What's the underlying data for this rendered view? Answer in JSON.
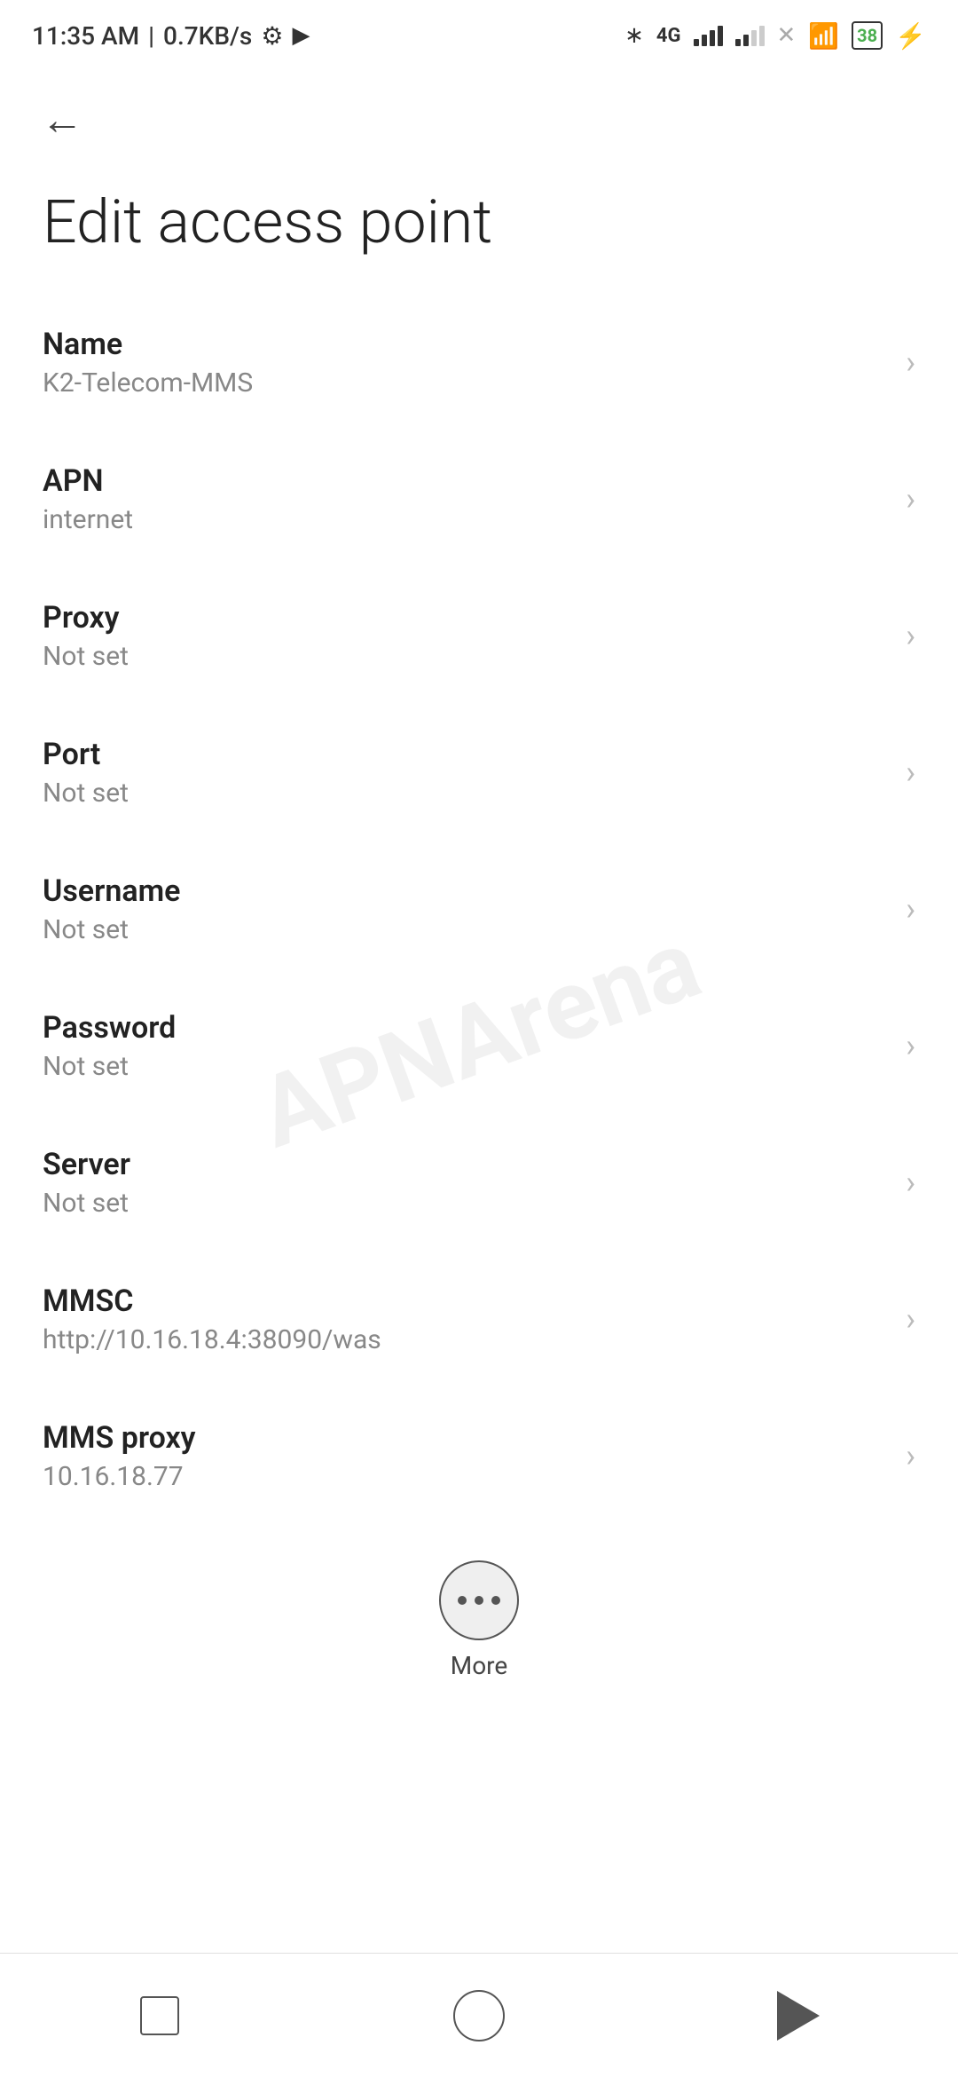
{
  "status_bar": {
    "time": "11:35 AM",
    "speed": "0.7KB/s"
  },
  "header": {
    "back_label": "←",
    "title": "Edit access point"
  },
  "settings_items": [
    {
      "id": "name",
      "label": "Name",
      "value": "K2-Telecom-MMS"
    },
    {
      "id": "apn",
      "label": "APN",
      "value": "internet"
    },
    {
      "id": "proxy",
      "label": "Proxy",
      "value": "Not set"
    },
    {
      "id": "port",
      "label": "Port",
      "value": "Not set"
    },
    {
      "id": "username",
      "label": "Username",
      "value": "Not set"
    },
    {
      "id": "password",
      "label": "Password",
      "value": "Not set"
    },
    {
      "id": "server",
      "label": "Server",
      "value": "Not set"
    },
    {
      "id": "mmsc",
      "label": "MMSC",
      "value": "http://10.16.18.4:38090/was"
    },
    {
      "id": "mms-proxy",
      "label": "MMS proxy",
      "value": "10.16.18.77"
    }
  ],
  "more_button": {
    "label": "More"
  },
  "watermark": "APNArena"
}
